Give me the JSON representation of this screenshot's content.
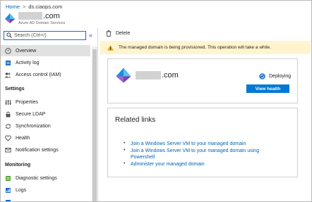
{
  "breadcrumb": {
    "home": "Home",
    "separator": ">",
    "current": "ds.ciaops.com"
  },
  "header": {
    "title_suffix": ".com",
    "subtitle": "Azure AD Domain Services"
  },
  "search": {
    "placeholder": "Search (Ctrl+/)",
    "collapse": "«"
  },
  "sidebar": {
    "items": [
      {
        "label": "Overview",
        "icon": "overview-icon"
      },
      {
        "label": "Activity log",
        "icon": "activity-log-icon"
      },
      {
        "label": "Access control (IAM)",
        "icon": "people-icon"
      }
    ],
    "settings_heading": "Settings",
    "settings": [
      {
        "label": "Properties",
        "icon": "properties-icon"
      },
      {
        "label": "Secure LDAP",
        "icon": "lock-icon"
      },
      {
        "label": "Synchronization",
        "icon": "sync-icon"
      },
      {
        "label": "Health",
        "icon": "heart-icon"
      },
      {
        "label": "Notification settings",
        "icon": "bell-icon"
      }
    ],
    "monitoring_heading": "Monitoring",
    "monitoring": [
      {
        "label": "Diagnostic settings",
        "icon": "diagnostic-icon"
      },
      {
        "label": "Logs",
        "icon": "logs-icon"
      }
    ]
  },
  "toolbar": {
    "delete_label": "Delete"
  },
  "warning": {
    "text": "The managed domain is being provisioned. This operation will take a while."
  },
  "domain_card": {
    "domain_suffix": ".com",
    "status": "Deploying",
    "view_health": "View health"
  },
  "related": {
    "title": "Related links",
    "links": [
      "Join a Windows Server VM to your managed domain",
      "Join a Windows Server VM to your managed domain using Powershell",
      "Administer your managed domain"
    ]
  },
  "colors": {
    "accent": "#0078d4",
    "warning_bg": "#fff4ce",
    "link": "#0063b1",
    "active_bg": "#e1e1e1"
  }
}
